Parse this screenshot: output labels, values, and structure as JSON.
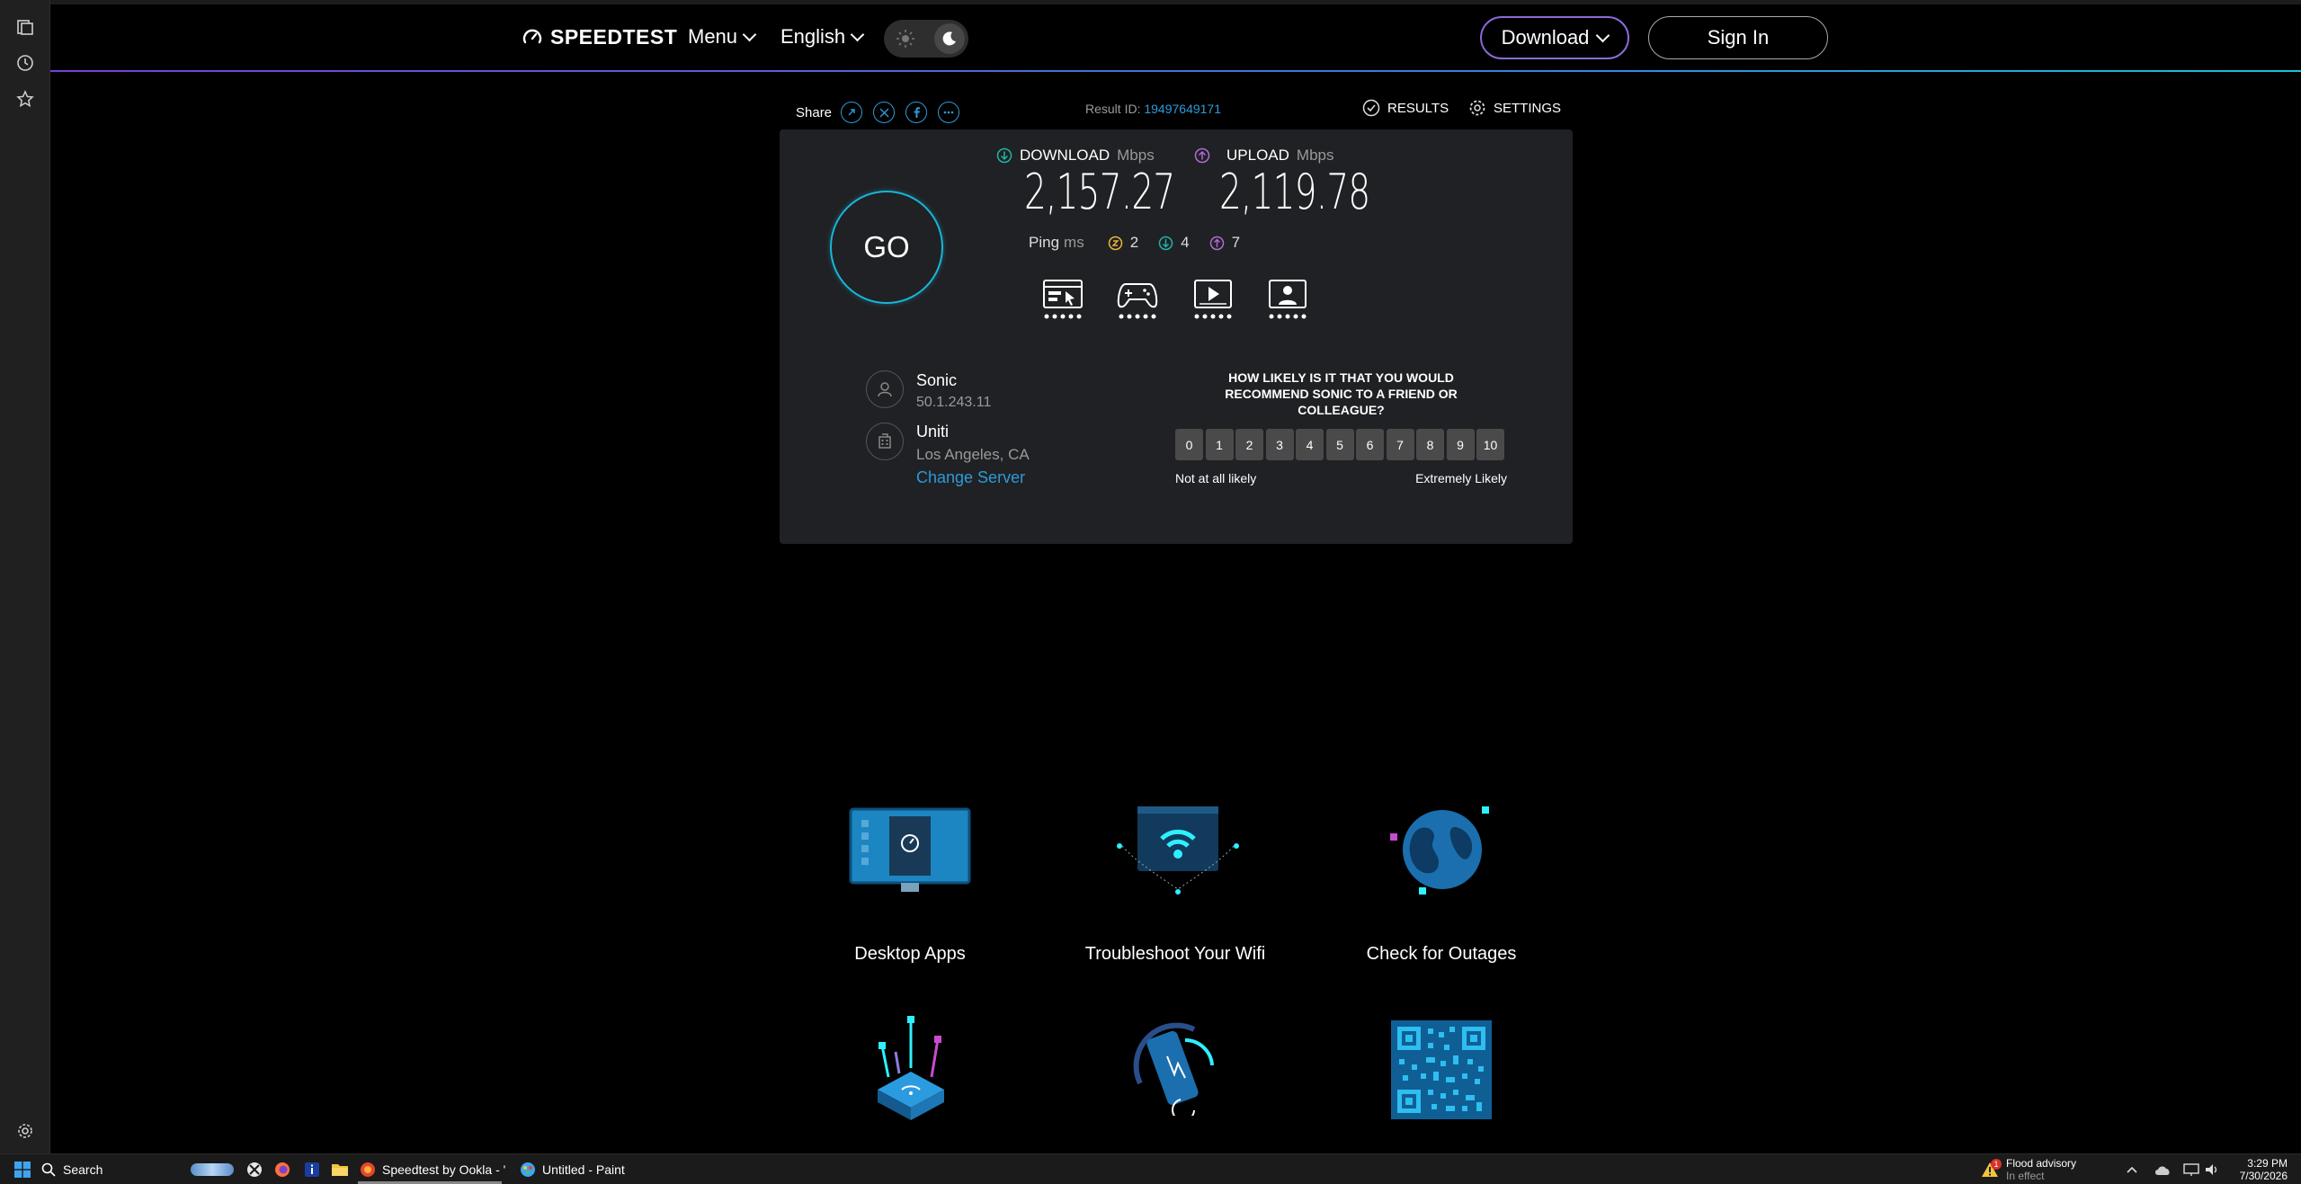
{
  "nav": {
    "logo_text": "SPEEDTEST",
    "menu_label": "Menu",
    "language_label": "English",
    "download_label": "Download",
    "signin_label": "Sign In"
  },
  "share_bar": {
    "share_label": "Share",
    "result_id_label": "Result ID:",
    "result_id_value": "19497649171",
    "results_label": "RESULTS",
    "settings_label": "SETTINGS"
  },
  "result": {
    "download_label": "DOWNLOAD",
    "upload_label": "UPLOAD",
    "unit": "Mbps",
    "download_value": "2,157.27",
    "upload_value": "2,119.78",
    "ping_label": "Ping",
    "ping_unit": "ms",
    "ping_idle": "2",
    "ping_download": "4",
    "ping_upload": "7",
    "go_label": "GO",
    "isp_name": "Sonic",
    "isp_ip": "50.1.243.11",
    "server_name": "Uniti",
    "server_location": "Los Angeles, CA",
    "change_server_label": "Change Server"
  },
  "survey": {
    "question": "HOW LIKELY IS IT THAT YOU WOULD RECOMMEND SONIC TO A FRIEND OR COLLEAGUE?",
    "scale": [
      "0",
      "1",
      "2",
      "3",
      "4",
      "5",
      "6",
      "7",
      "8",
      "9",
      "10"
    ],
    "low_label": "Not at all likely",
    "high_label": "Extremely Likely"
  },
  "features": [
    {
      "label": "Desktop Apps"
    },
    {
      "label": "Troubleshoot Your Wifi"
    },
    {
      "label": "Check for Outages"
    }
  ],
  "taskbar": {
    "search_label": "Search",
    "app1_label": "Speedtest by Ookla - '",
    "app2_label": "Untitled - Paint",
    "weather_title": "Flood advisory",
    "weather_sub": "In effect",
    "weather_badge": "1",
    "time": "3:29 PM",
    "date": "7/30/2026"
  },
  "colors": {
    "accent_cyan": "#19b5d8",
    "link_blue": "#2c9bd8",
    "upload_purple": "#b36ad6",
    "download_teal": "#1fb5a8",
    "ping_yellow": "#e8b63a"
  }
}
